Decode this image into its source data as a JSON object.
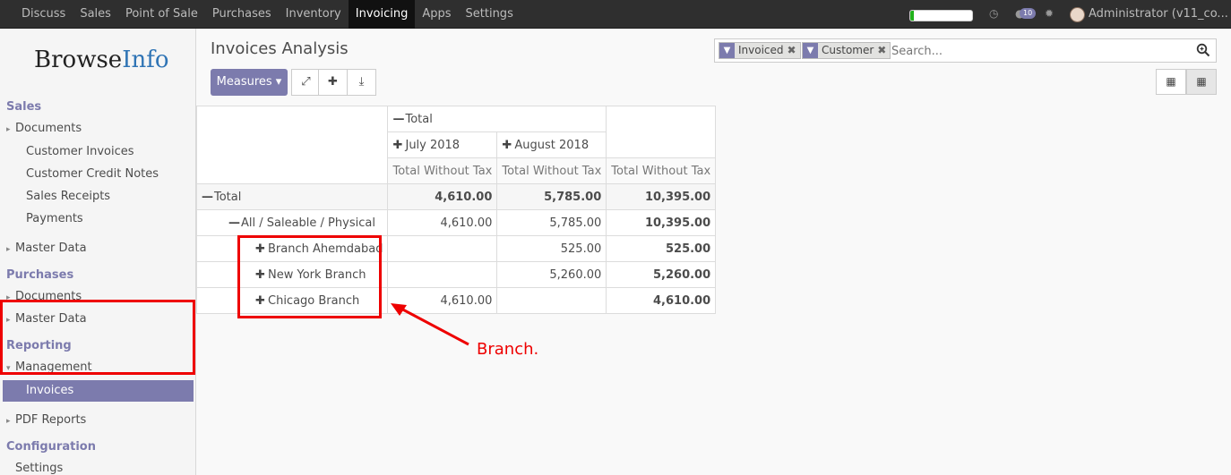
{
  "topbar": {
    "menu": [
      "Discuss",
      "Sales",
      "Point of Sale",
      "Purchases",
      "Inventory",
      "Invoicing",
      "Apps",
      "Settings"
    ],
    "active": "Invoicing",
    "progress": 0.06,
    "messages_badge": "10",
    "user": "Administrator (v11_co..."
  },
  "sidebar": {
    "logo_a": "Browse",
    "logo_b": "Info",
    "sales": "Sales",
    "documents": "Documents",
    "customer_invoices": "Customer Invoices",
    "customer_credit_notes": "Customer Credit Notes",
    "sales_receipts": "Sales Receipts",
    "payments": "Payments",
    "master_data": "Master Data",
    "purchases": "Purchases",
    "p_documents": "Documents",
    "p_master_data": "Master Data",
    "reporting": "Reporting",
    "management": "Management",
    "invoices": "Invoices",
    "pdf_reports": "PDF Reports",
    "configuration": "Configuration",
    "settings": "Settings"
  },
  "header": {
    "title": "Invoices Analysis",
    "measures": "Measures",
    "facets": [
      "Invoiced",
      "Customer"
    ],
    "search_placeholder": "Search..."
  },
  "pivot": {
    "total": "Total",
    "col1": "July 2018",
    "col2": "August 2018",
    "measure": "Total Without Tax",
    "rows": [
      {
        "label": "Total",
        "c1": "4,610.00",
        "c2": "5,785.00",
        "t": "10,395.00"
      },
      {
        "label": "All / Saleable / Physical",
        "c1": "4,610.00",
        "c2": "5,785.00",
        "t": "10,395.00"
      },
      {
        "label": "Branch Ahemdabad",
        "c1": "",
        "c2": "525.00",
        "t": "525.00"
      },
      {
        "label": "New York Branch",
        "c1": "",
        "c2": "5,260.00",
        "t": "5,260.00"
      },
      {
        "label": "Chicago Branch",
        "c1": "4,610.00",
        "c2": "",
        "t": "4,610.00"
      }
    ]
  },
  "annotation": "Branch."
}
